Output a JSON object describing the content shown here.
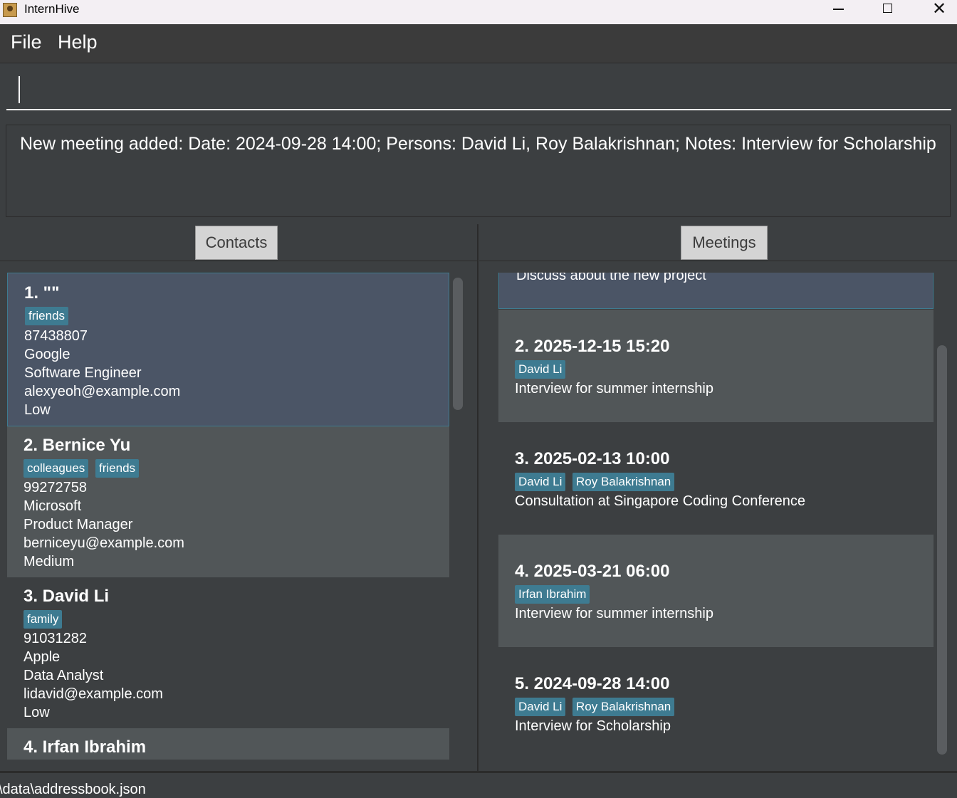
{
  "window": {
    "title": "InternHive"
  },
  "menu": {
    "file": "File",
    "help": "Help"
  },
  "command": {
    "value": ""
  },
  "result": {
    "text": "New meeting added: Date: 2024-09-28 14:00; Persons: David Li, Roy Balakrishnan; Notes: Interview for Scholarship"
  },
  "contacts_panel": {
    "tab_label": "Contacts",
    "items": [
      {
        "title": "1.  \"\"",
        "tags": [
          "friends"
        ],
        "phone": "87438807",
        "company": "Google",
        "role": "Software Engineer",
        "email": "alexyeoh@example.com",
        "priority": "Low"
      },
      {
        "title": "2.  Bernice Yu",
        "tags": [
          "colleagues",
          "friends"
        ],
        "phone": "99272758",
        "company": "Microsoft",
        "role": "Product Manager",
        "email": "berniceyu@example.com",
        "priority": "Medium"
      },
      {
        "title": "3.  David Li",
        "tags": [
          "family"
        ],
        "phone": "91031282",
        "company": "Apple",
        "role": "Data Analyst",
        "email": "lidavid@example.com",
        "priority": "Low"
      },
      {
        "title": "4.  Irfan Ibrahim"
      }
    ]
  },
  "meetings_panel": {
    "tab_label": "Meetings",
    "items": [
      {
        "notes": "Discuss about the new project"
      },
      {
        "title": "2.  2025-12-15 15:20",
        "persons": [
          "David Li"
        ],
        "notes": "Interview for summer internship"
      },
      {
        "title": "3.  2025-02-13 10:00",
        "persons": [
          "David Li",
          "Roy Balakrishnan"
        ],
        "notes": "Consultation at Singapore Coding Conference"
      },
      {
        "title": "4.  2025-03-21 06:00",
        "persons": [
          "Irfan Ibrahim"
        ],
        "notes": "Interview for summer internship"
      },
      {
        "title": "5.  2024-09-28 14:00",
        "persons": [
          "David Li",
          "Roy Balakrishnan"
        ],
        "notes": "Interview for Scholarship"
      }
    ]
  },
  "status": {
    "path": "\\data\\addressbook.json"
  },
  "colors": {
    "background": "#3c3f41",
    "selected": "#4b5566",
    "tag": "#3e7b91",
    "card_alt": "#515658"
  }
}
